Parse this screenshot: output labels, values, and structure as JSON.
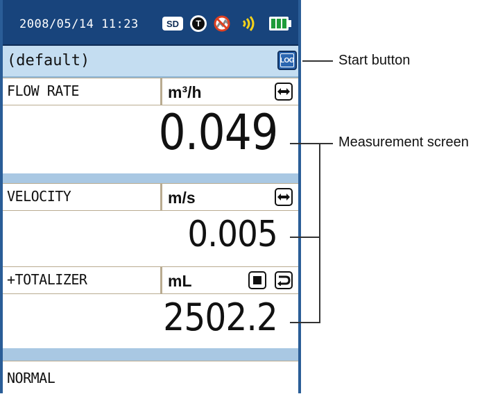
{
  "status_bar": {
    "datetime": "2008/05/14  11:23",
    "sd_label": "SD",
    "t_label": "T",
    "icons": [
      "sd-card-icon",
      "t-mode-icon",
      "no-signal-icon",
      "signal-strength-icon",
      "battery-icon"
    ]
  },
  "header": {
    "setting_name": "(default)",
    "log_button_label": "LOG"
  },
  "measurements": [
    {
      "label": "FLOW RATE",
      "unit": "m³/h",
      "value": "0.049"
    },
    {
      "label": "VELOCITY",
      "unit": "m/s",
      "value": "0.005"
    },
    {
      "label": "+TOTALIZER",
      "unit": "mL",
      "value": "2502.2"
    }
  ],
  "status": "NORMAL",
  "annotations": {
    "start_button": "Start button",
    "measurement_screen": "Measurement screen"
  },
  "colors": {
    "status_bar_bg": "#18447c",
    "band_bg": "#c4ddf1",
    "log_button": "#2b66b0"
  }
}
